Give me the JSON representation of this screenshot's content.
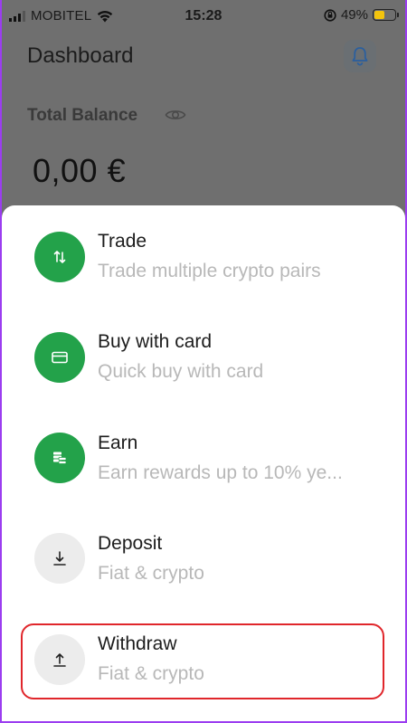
{
  "status_bar": {
    "carrier": "MOBITEL",
    "time": "15:28",
    "battery_percent": "49%",
    "battery_color": "#f3c40d"
  },
  "dashboard": {
    "title": "Dashboard",
    "total_balance_label": "Total Balance",
    "balance_value": "0,00 €",
    "icons": [
      "bell-icon",
      "eye-icon"
    ]
  },
  "sheet": {
    "items": [
      {
        "title": "Trade",
        "subtitle": "Trade multiple crypto pairs",
        "icon": "swap-arrows-icon",
        "style": "green"
      },
      {
        "title": "Buy with card",
        "subtitle": "Quick buy with card",
        "icon": "card-icon",
        "style": "green"
      },
      {
        "title": "Earn",
        "subtitle": "Earn rewards up to 10% ye...",
        "icon": "coins-icon",
        "style": "green"
      },
      {
        "title": "Deposit",
        "subtitle": "Fiat & crypto",
        "icon": "arrow-down-icon",
        "style": "grey"
      },
      {
        "title": "Withdraw",
        "subtitle": "Fiat & crypto",
        "icon": "arrow-up-icon",
        "style": "grey",
        "highlighted": true
      }
    ]
  },
  "colors": {
    "accent_green": "#23a24a",
    "highlight_red": "#e0262b",
    "frame_purple": "#9b3df0"
  }
}
